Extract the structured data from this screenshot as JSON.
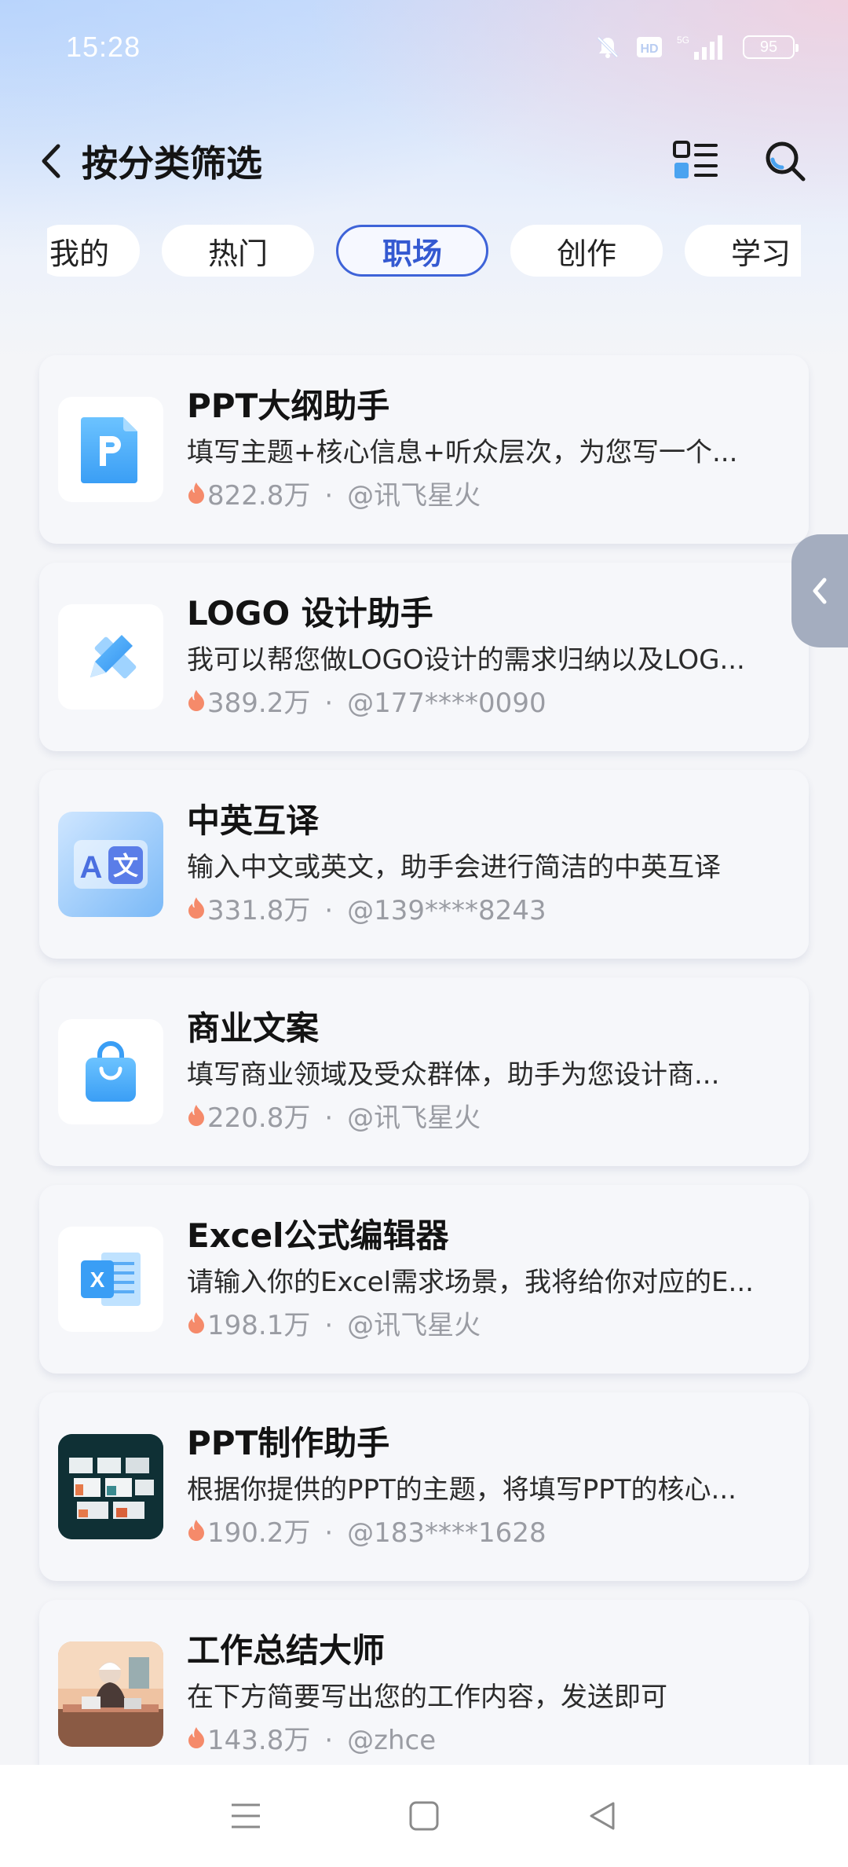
{
  "status_bar": {
    "time": "15:28",
    "network": "5G",
    "battery": "95",
    "icons": [
      "mute-icon",
      "hd-icon",
      "signal-icon",
      "battery-icon"
    ]
  },
  "header": {
    "title": "按分类筛选",
    "icons": [
      "back-icon",
      "layout-grid-icon",
      "search-icon"
    ]
  },
  "tabs": [
    {
      "label": "我的",
      "active": false
    },
    {
      "label": "热门",
      "active": false
    },
    {
      "label": "职场",
      "active": true
    },
    {
      "label": "创作",
      "active": false
    },
    {
      "label": "学习",
      "active": false
    }
  ],
  "assistants": [
    {
      "title": "PPT大纲助手",
      "desc": "填写主题+核心信息+听众层次，为您写一个...",
      "count": "822.8万",
      "author": "@讯飞星火",
      "icon": "ppt-file-icon"
    },
    {
      "title": "LOGO 设计助手",
      "desc": "我可以帮您做LOGO设计的需求归纳以及LOG...",
      "count": "389.2万",
      "author": "@177****0090",
      "icon": "pencil-ruler-icon"
    },
    {
      "title": "中英互译",
      "desc": "输入中文或英文，助手会进行简洁的中英互译",
      "count": "331.8万",
      "author": "@139****8243",
      "icon": "translate-icon"
    },
    {
      "title": "商业文案",
      "desc": "填写商业领域及受众群体，助手为您设计商...",
      "count": "220.8万",
      "author": "@讯飞星火",
      "icon": "shopping-bag-icon"
    },
    {
      "title": "Excel公式编辑器",
      "desc": "请输入你的Excel需求场景，我将给你对应的E...",
      "count": "198.1万",
      "author": "@讯飞星火",
      "icon": "excel-icon"
    },
    {
      "title": "PPT制作助手",
      "desc": "根据你提供的PPT的主题，将填写PPT的核心...",
      "count": "190.2万",
      "author": "@183****1628",
      "icon": "ppt-slides-thumbnail"
    },
    {
      "title": "工作总结大师",
      "desc": "在下方简要写出您的工作内容，发送即可",
      "count": "143.8万",
      "author": "@zhce",
      "icon": "worker-illustration-thumbnail"
    }
  ],
  "meta_separator": "·",
  "accent_color": "#3e63d8",
  "flame_color": "#f58a6a"
}
